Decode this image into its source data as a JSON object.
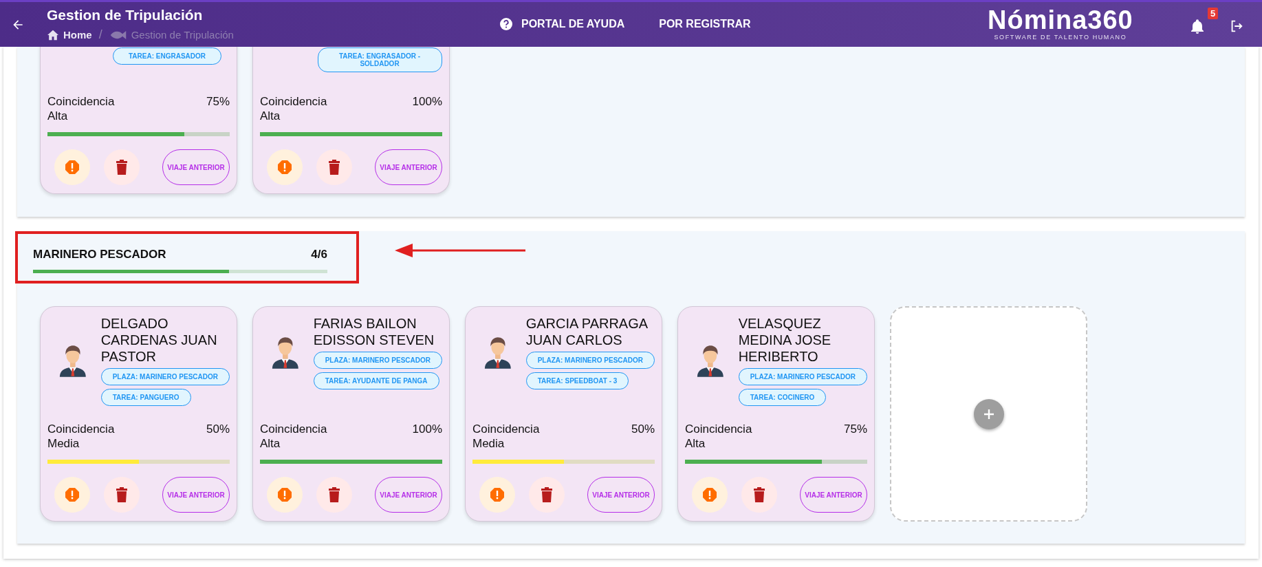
{
  "header": {
    "title": "Gestion de Tripulación",
    "breadcrumb_separator": "/",
    "breadcrumb": [
      {
        "label": "Home",
        "kind": "home"
      },
      {
        "label": "Gestion de Tripulación",
        "kind": "fish"
      }
    ],
    "nav": [
      {
        "label": "PORTAL DE AYUDA",
        "kind": "help"
      },
      {
        "label": "POR REGISTRAR",
        "kind": "plain"
      }
    ],
    "logo": {
      "name": "Nómina360",
      "tagline": "SOFTWARE DE TALENTO HUMANO"
    },
    "notifications": "5"
  },
  "sections": [
    {
      "cards": [
        {
          "tags": [
            "TAREA: ENGRASADOR"
          ],
          "match": "Coincidencia Alta",
          "percent": "75%",
          "level": 0.75,
          "color": "#4caf50",
          "action": "VIAJE ANTERIOR"
        },
        {
          "tags": [
            "TAREA: ENGRASADOR - SOLDADOR"
          ],
          "match": "Coincidencia Alta",
          "percent": "100%",
          "level": 1,
          "color": "#4caf50",
          "action": "VIAJE ANTERIOR"
        }
      ],
      "add_slot": false
    },
    {
      "title": "MARINERO PESCADOR",
      "count": "4/6",
      "level": 0.667,
      "highlighted": true,
      "cards": [
        {
          "name": "DELGADO CARDENAS JUAN PASTOR",
          "tags": [
            "PLAZA: MARINERO PESCADOR",
            "TAREA: PANGUERO"
          ],
          "match": "Coincidencia Media",
          "percent": "50%",
          "level": 0.5,
          "color": "#ffeb3b",
          "action": "VIAJE ANTERIOR"
        },
        {
          "name": "FARIAS BAILON EDISSON STEVEN",
          "tags": [
            "PLAZA: MARINERO PESCADOR",
            "TAREA: AYUDANTE DE PANGA"
          ],
          "match": "Coincidencia Alta",
          "percent": "100%",
          "level": 1,
          "color": "#4caf50",
          "action": "VIAJE ANTERIOR"
        },
        {
          "name": "GARCIA PARRAGA JUAN CARLOS",
          "tags": [
            "PLAZA: MARINERO PESCADOR",
            "TAREA: SPEEDBOAT - 3"
          ],
          "match": "Coincidencia Media",
          "percent": "50%",
          "level": 0.5,
          "color": "#ffeb3b",
          "action": "VIAJE ANTERIOR"
        },
        {
          "name": "VELASQUEZ MEDINA JOSE HERIBERTO",
          "tags": [
            "PLAZA: MARINERO PESCADOR",
            "TAREA: COCINERO"
          ],
          "match": "Coincidencia Alta",
          "percent": "75%",
          "level": 0.75,
          "color": "#4caf50",
          "action": "VIAJE ANTERIOR"
        }
      ],
      "add_slot": true
    }
  ]
}
